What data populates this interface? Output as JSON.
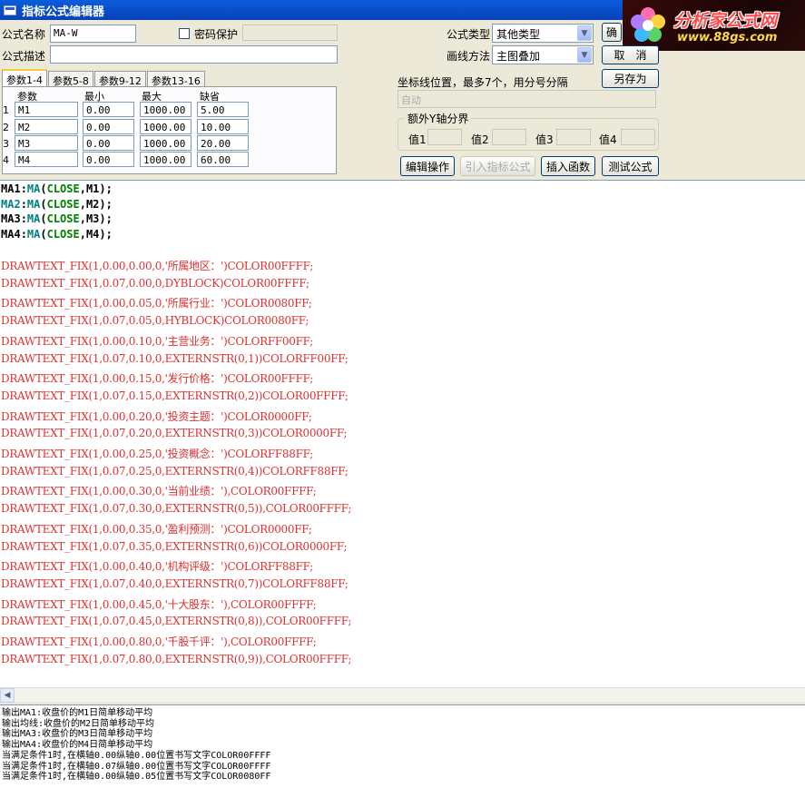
{
  "window": {
    "title": "指标公式编辑器"
  },
  "logo": {
    "brand": "分析家公式网",
    "url": "www.88gs.com"
  },
  "form": {
    "name_label": "公式名称",
    "name_value": "MA-W",
    "password_label": "密码保护",
    "desc_label": "公式描述",
    "desc_value": "",
    "type_label": "公式类型",
    "type_value": "其他类型",
    "draw_label": "画线方法",
    "draw_value": "主图叠加",
    "coord_label": "坐标线位置，最多7个，用分号分隔",
    "coord_placeholder": "自动",
    "yaxis_group_label": "额外Y轴分界",
    "yaxis_values": [
      "值1",
      "值2",
      "值3",
      "值4"
    ]
  },
  "buttons": {
    "ok": "确",
    "cancel": "取　消",
    "save_as": "另存为",
    "edit_ops": "编辑操作",
    "import": "引入指标公式",
    "insert_func": "插入函数",
    "test": "测试公式"
  },
  "tabs": [
    "参数1-4",
    "参数5-8",
    "参数9-12",
    "参数13-16"
  ],
  "params": {
    "headers": [
      "参数",
      "最小",
      "最大",
      "缺省"
    ],
    "rows": [
      {
        "num": "1",
        "name": "M1",
        "min": "0.00",
        "max": "1000.00",
        "default": "5.00"
      },
      {
        "num": "2",
        "name": "M2",
        "min": "0.00",
        "max": "1000.00",
        "default": "10.00"
      },
      {
        "num": "3",
        "name": "M3",
        "min": "0.00",
        "max": "1000.00",
        "default": "20.00"
      },
      {
        "num": "4",
        "name": "M4",
        "min": "0.00",
        "max": "1000.00",
        "default": "60.00"
      }
    ]
  },
  "code": {
    "ma_lines": [
      {
        "var": "MA1",
        "arg": "M1"
      },
      {
        "var": "MA2",
        "arg": "M2"
      },
      {
        "var": "MA3",
        "arg": "M3"
      },
      {
        "var": "MA4",
        "arg": "M4"
      }
    ],
    "ma_func": "MA",
    "ma_close": "CLOSE",
    "draw_lines": [
      "DRAWTEXT_FIX(1,0.00,0.00,0,'所属地区：')COLOR00FFFF;",
      "DRAWTEXT_FIX(1,0.07,0.00,0,DYBLOCK)COLOR00FFFF;",
      "DRAWTEXT_FIX(1,0.00,0.05,0,'所属行业：')COLOR0080FF;",
      "DRAWTEXT_FIX(1,0.07,0.05,0,HYBLOCK)COLOR0080FF;",
      "DRAWTEXT_FIX(1,0.00,0.10,0,'主营业务：')COLORFF00FF;",
      "DRAWTEXT_FIX(1,0.07,0.10,0,EXTERNSTR(0,1))COLORFF00FF;",
      "DRAWTEXT_FIX(1,0.00,0.15,0,'发行价格：')COLOR00FFFF;",
      "DRAWTEXT_FIX(1,0.07,0.15,0,EXTERNSTR(0,2))COLOR00FFFF;",
      "DRAWTEXT_FIX(1,0.00,0.20,0,'投资主题：')COLOR0000FF;",
      "DRAWTEXT_FIX(1,0.07,0.20,0,EXTERNSTR(0,3))COLOR0000FF;",
      "DRAWTEXT_FIX(1,0.00,0.25,0,'投资概念：')COLORFF88FF;",
      "DRAWTEXT_FIX(1,0.07,0.25,0,EXTERNSTR(0,4))COLORFF88FF;",
      "DRAWTEXT_FIX(1,0.00,0.30,0,'当前业绩：'),COLOR00FFFF;",
      "DRAWTEXT_FIX(1,0.07,0.30,0,EXTERNSTR(0,5)),COLOR00FFFF;",
      "DRAWTEXT_FIX(1,0.00,0.35,0,'盈利预测：')COLOR0000FF;",
      "DRAWTEXT_FIX(1,0.07,0.35,0,EXTERNSTR(0,6))COLOR0000FF;",
      "DRAWTEXT_FIX(1,0.00,0.40,0,'机构评级：')COLORFF88FF;",
      "DRAWTEXT_FIX(1,0.07,0.40,0,EXTERNSTR(0,7))COLORFF88FF;",
      "DRAWTEXT_FIX(1,0.00,0.45,0,'十大股东：'),COLOR00FFFF;",
      "DRAWTEXT_FIX(1,0.07,0.45,0,EXTERNSTR(0,8)),COLOR00FFFF;",
      "DRAWTEXT_FIX(1,0.00,0.80,0,'千股千评：'),COLOR00FFFF;",
      "DRAWTEXT_FIX(1,0.07,0.80,0,EXTERNSTR(0,9)),COLOR00FFFF;"
    ]
  },
  "output": [
    "输出MA1:收盘价的M1日简单移动平均",
    "输出均线:收盘价的M2日简单移动平均",
    "输出MA3:收盘价的M3日简单移动平均",
    "输出MA4:收盘价的M4日简单移动平均",
    "当满足条件1时,在横轴0.00纵轴0.00位置书写文字COLOR00FFFF",
    "当满足条件1时,在横轴0.07纵轴0.00位置书写文字COLOR00FFFF",
    "当满足条件1时,在横轴0.00纵轴0.05位置书写文字COLOR0080FF"
  ],
  "colors": {
    "title_bar": "#0A5DDB",
    "draw_text": "#E03030",
    "code_teal": "#008080",
    "code_green": "#008000"
  }
}
